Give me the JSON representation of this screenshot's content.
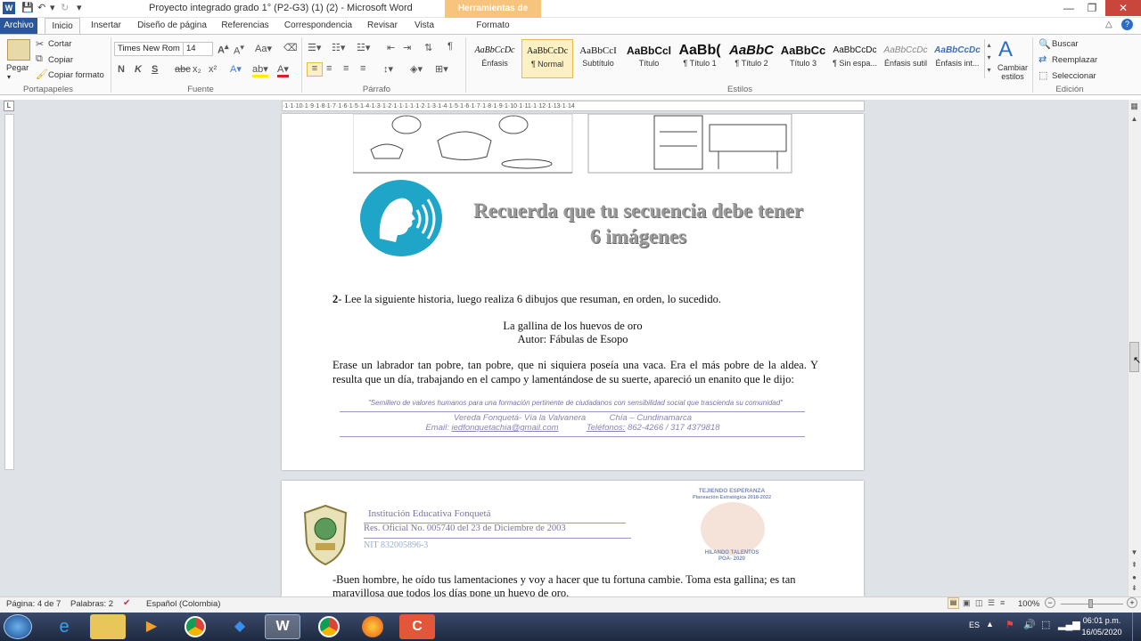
{
  "window": {
    "title": "Proyecto integrado grado 1° (P2-G3) (1) (2)  -  Microsoft Word",
    "contextual_tab_header": "Herramientas de dibujo"
  },
  "ribbon_tabs": [
    "Archivo",
    "Inicio",
    "Insertar",
    "Diseño de página",
    "Referencias",
    "Correspondencia",
    "Revisar",
    "Vista",
    "Formato"
  ],
  "clipboard": {
    "paste": "Pegar",
    "cut": "Cortar",
    "copy": "Copiar",
    "format_painter": "Copiar formato",
    "group": "Portapapeles"
  },
  "font": {
    "name": "Times New Rom",
    "size": "14",
    "group": "Fuente"
  },
  "paragraph": {
    "group": "Párrafo"
  },
  "styles": {
    "group": "Estilos",
    "items": [
      {
        "sample": "AaBbCcDc",
        "name": "Énfasis"
      },
      {
        "sample": "AaBbCcDc",
        "name": "¶ Normal"
      },
      {
        "sample": "AaBbCcI",
        "name": "Subtítulo"
      },
      {
        "sample": "AaBbCcl",
        "name": "Título"
      },
      {
        "sample": "AaBb(",
        "name": "¶ Título 1"
      },
      {
        "sample": "AaBbC",
        "name": "¶ Título 2"
      },
      {
        "sample": "AaBbCc",
        "name": "Título 3"
      },
      {
        "sample": "AaBbCcDc",
        "name": "¶ Sin espa..."
      },
      {
        "sample": "AaBbCcDc",
        "name": "Énfasis sutil"
      },
      {
        "sample": "AaBbCcDc",
        "name": "Énfasis int..."
      }
    ],
    "change": "Cambiar estilos"
  },
  "editing": {
    "find": "Buscar",
    "replace": "Reemplazar",
    "select": "Seleccionar",
    "group": "Edición"
  },
  "ruler_text": "·1·1·10·1·9·1·8·1·7·1·6·1·5·1·4·1·3·1·2·1·1·1·1·1·2·1·3·1·4·1·5·1·6·1·7·1·8·1·9·1·10·1·11·1·12·1·13·1·14",
  "page1": {
    "callout": "Recuerda que tu secuencia debe tener 6 imágenes",
    "instruction_num": "2",
    "instruction": "- Lee la siguiente historia, luego realiza 6 dibujos que resuman, en orden, lo sucedido.",
    "story_title": "La gallina de los huevos de oro",
    "story_author": "Autor: Fábulas de Esopo",
    "story_p1": "Erase un labrador tan pobre, tan pobre, que ni siquiera poseía una vaca. Era el más pobre de la aldea. Y resulta que un día, trabajando en el campo y lamentándose de su suerte, apareció un enanito que le dijo:",
    "footer_motto": "\"Semillero de valores humanos para una formación pertinente de ciudadanos con sensibilidad social que trascienda su comunidad\"",
    "footer_address": "Vereda Fonquetá- Vía la Valvanera          Chía – Cundinamarca",
    "footer_email_label": "Email:",
    "footer_email": "iedfonquetachia@gmail.com",
    "footer_phone_label": "Teléfonos:",
    "footer_phones": "862-4266 / 317 4379818"
  },
  "page2": {
    "inst_name": "Institución Educativa Fonquetá",
    "inst_res": "Res. Oficial  No.  005740  del 23 de Diciembre de 2003",
    "inst_nit": "NIT 832005896-3",
    "plan_line1": "TEJIENDO ESPERANZA",
    "plan_line2": "Planeación Estratégica 2018-2022",
    "plan_line3": "HILANDO TALENTOS",
    "plan_line4": "POA- 2020",
    "body_line1": "-Buen hombre, he oído tus lamentaciones y voy a hacer que tu fortuna cambie. Toma esta gallina; es tan",
    "body_line2": "maravillosa  que todos los días pone un huevo de oro."
  },
  "status": {
    "page": "Página: 4 de 7",
    "words": "Palabras: 2",
    "language": "Español (Colombia)",
    "zoom": "100%"
  },
  "taskbar": {
    "lang": "ES",
    "time": "06:01 p.m.",
    "date": "16/05/2020"
  },
  "colors": {
    "accent": "#2b579a",
    "contextual": "#f6c47c",
    "callout_icon": "#1ea5c8",
    "footer_text": "#7b72a8"
  }
}
